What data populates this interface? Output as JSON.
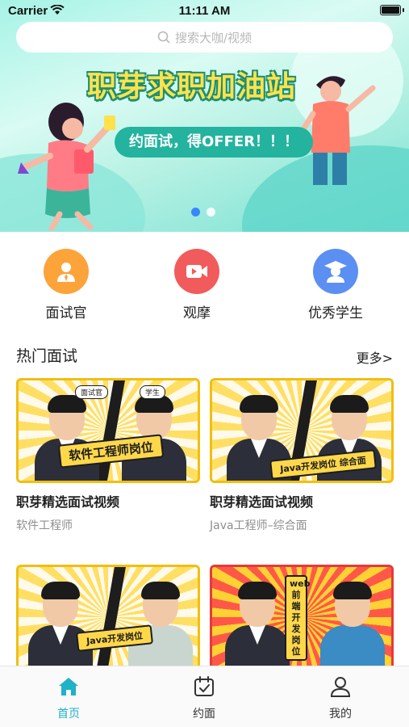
{
  "status_bar": {
    "carrier": "Carrier",
    "time": "11:11 AM"
  },
  "search": {
    "placeholder": "搜索大咖/视频"
  },
  "banner": {
    "title": "职芽求职加油站",
    "subtitle": "约面试，得OFFER！！！",
    "slides": 2,
    "active_slide": 0
  },
  "menu": [
    {
      "label": "面试官",
      "icon": "interviewer-icon",
      "color": "#fca33a"
    },
    {
      "label": "观摩",
      "icon": "video-camera-icon",
      "color": "#f25b5b"
    },
    {
      "label": "优秀学生",
      "icon": "graduate-icon",
      "color": "#5b8ff2"
    }
  ],
  "section": {
    "title": "热门面试",
    "more": "更多>"
  },
  "cards": [
    {
      "title": "职芽精选面试视频",
      "subtitle": "软件工程师",
      "thumb_caption": "软件工程师岗位",
      "badges": [
        "面试官",
        "学生"
      ]
    },
    {
      "title": "职芽精选面试视频",
      "subtitle": "Java工程师–综合面",
      "thumb_caption": "Java开发岗位 综合面",
      "badges": []
    },
    {
      "title": "",
      "subtitle": "",
      "thumb_caption": "Java开发岗位",
      "badges": []
    },
    {
      "title": "",
      "subtitle": "",
      "thumb_caption": "web前端开发岗位",
      "badges": []
    }
  ],
  "tabs": [
    {
      "label": "首页",
      "icon": "home-icon",
      "active": true
    },
    {
      "label": "约面",
      "icon": "calendar-check-icon",
      "active": false
    },
    {
      "label": "我的",
      "icon": "user-icon",
      "active": false
    }
  ],
  "colors": {
    "accent": "#1fb2c9",
    "dot_active": "#2d7cff",
    "thumb_yellow": "#ffd233"
  }
}
